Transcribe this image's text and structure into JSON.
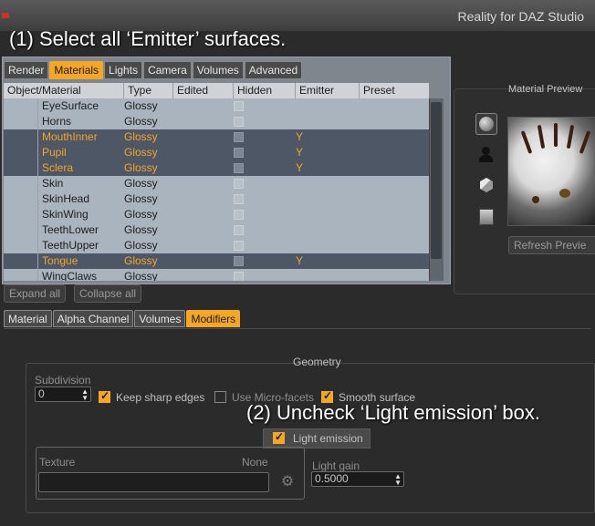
{
  "window": {
    "title": "Reality for DAZ Studio"
  },
  "callouts": {
    "step1": "(1) Select all ‘Emitter’ surfaces.",
    "step2": "(2) Uncheck ‘Light emission’ box."
  },
  "main_tabs": [
    {
      "label": "Render",
      "active": false
    },
    {
      "label": "Materials",
      "active": true
    },
    {
      "label": "Lights",
      "active": false
    },
    {
      "label": "Camera",
      "active": false
    },
    {
      "label": "Volumes",
      "active": false
    },
    {
      "label": "Advanced",
      "active": false
    }
  ],
  "table": {
    "headers": [
      "Object/Material",
      "Type",
      "Edited",
      "Hidden",
      "Emitter",
      "Preset"
    ],
    "rows": [
      {
        "name": "EyeSurface",
        "type": "Glossy",
        "emitter": "",
        "selected": false
      },
      {
        "name": "Horns",
        "type": "Glossy",
        "emitter": "",
        "selected": false
      },
      {
        "name": "MouthInner",
        "type": "Glossy",
        "emitter": "Y",
        "selected": true
      },
      {
        "name": "Pupil",
        "type": "Glossy",
        "emitter": "Y",
        "selected": true
      },
      {
        "name": "Sclera",
        "type": "Glossy",
        "emitter": "Y",
        "selected": true
      },
      {
        "name": "Skin",
        "type": "Glossy",
        "emitter": "",
        "selected": false
      },
      {
        "name": "SkinHead",
        "type": "Glossy",
        "emitter": "",
        "selected": false
      },
      {
        "name": "SkinWing",
        "type": "Glossy",
        "emitter": "",
        "selected": false
      },
      {
        "name": "TeethLower",
        "type": "Glossy",
        "emitter": "",
        "selected": false
      },
      {
        "name": "TeethUpper",
        "type": "Glossy",
        "emitter": "",
        "selected": false
      },
      {
        "name": "Tongue",
        "type": "Glossy",
        "emitter": "Y",
        "selected": true
      },
      {
        "name": "WingClaws",
        "type": "Glossy",
        "emitter": "",
        "selected": false
      }
    ]
  },
  "buttons": {
    "expand_all": "Expand all",
    "collapse_all": "Collapse all",
    "refresh_preview": "Refresh Previe"
  },
  "preview": {
    "label": "Material Preview"
  },
  "sub_tabs": [
    {
      "label": "Material",
      "active": false
    },
    {
      "label": "Alpha Channel",
      "active": false
    },
    {
      "label": "Volumes",
      "active": false
    },
    {
      "label": "Modifiers",
      "active": true
    }
  ],
  "geometry": {
    "title": "Geometry",
    "subdivision_label": "Subdivision",
    "subdivision_value": "0",
    "keep_sharp_edges": "Keep sharp edges",
    "use_micro_facets": "Use Micro-facets",
    "smooth_surface": "Smooth surface",
    "light_emission": "Light emission"
  },
  "texture": {
    "label": "Texture",
    "value": "None",
    "light_gain_label": "Light gain",
    "light_gain_value": "0.5000"
  },
  "colors": {
    "accent": "#f5a623",
    "selected_row": "#4d5765"
  }
}
